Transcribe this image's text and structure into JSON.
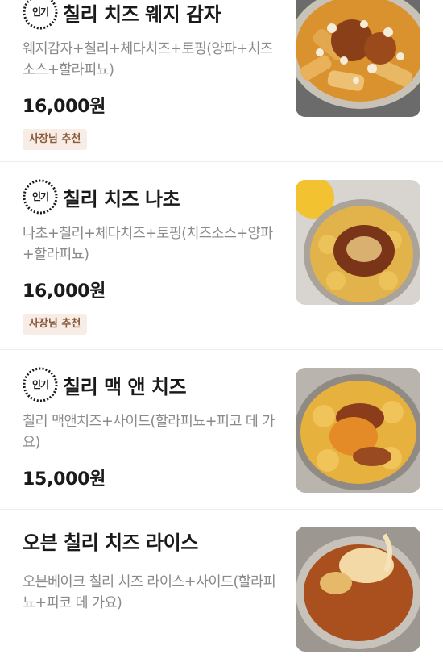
{
  "menu": {
    "popular_badge": "인기",
    "items": [
      {
        "name": "칠리 치즈 웨지 감자",
        "description": "웨지감자+칠리+체다치즈+토핑(양파+치즈소스+할라피뇨)",
        "price": "16,000원",
        "tag": "사장님 추천",
        "image": "chili-cheese-wedge-fries-photo"
      },
      {
        "name": "칠리 치즈 나초",
        "description": "나초+칠리+체다치즈+토핑(치즈소스+양파+할라피뇨)",
        "price": "16,000원",
        "tag": "사장님 추천",
        "image": "chili-cheese-nachos-photo"
      },
      {
        "name": "칠리 맥 앤 치즈",
        "description": "칠리 맥앤치즈+사이드(할라피뇨+피코 데 가요)",
        "price": "15,000원",
        "image": "chili-mac-and-cheese-photo"
      },
      {
        "name": "오븐 칠리 치즈 라이스",
        "description": "오븐베이크 칠리 치즈 라이스+사이드(할라피뇨+피코 데 가요)",
        "image": "oven-chili-cheese-rice-photo"
      }
    ]
  }
}
